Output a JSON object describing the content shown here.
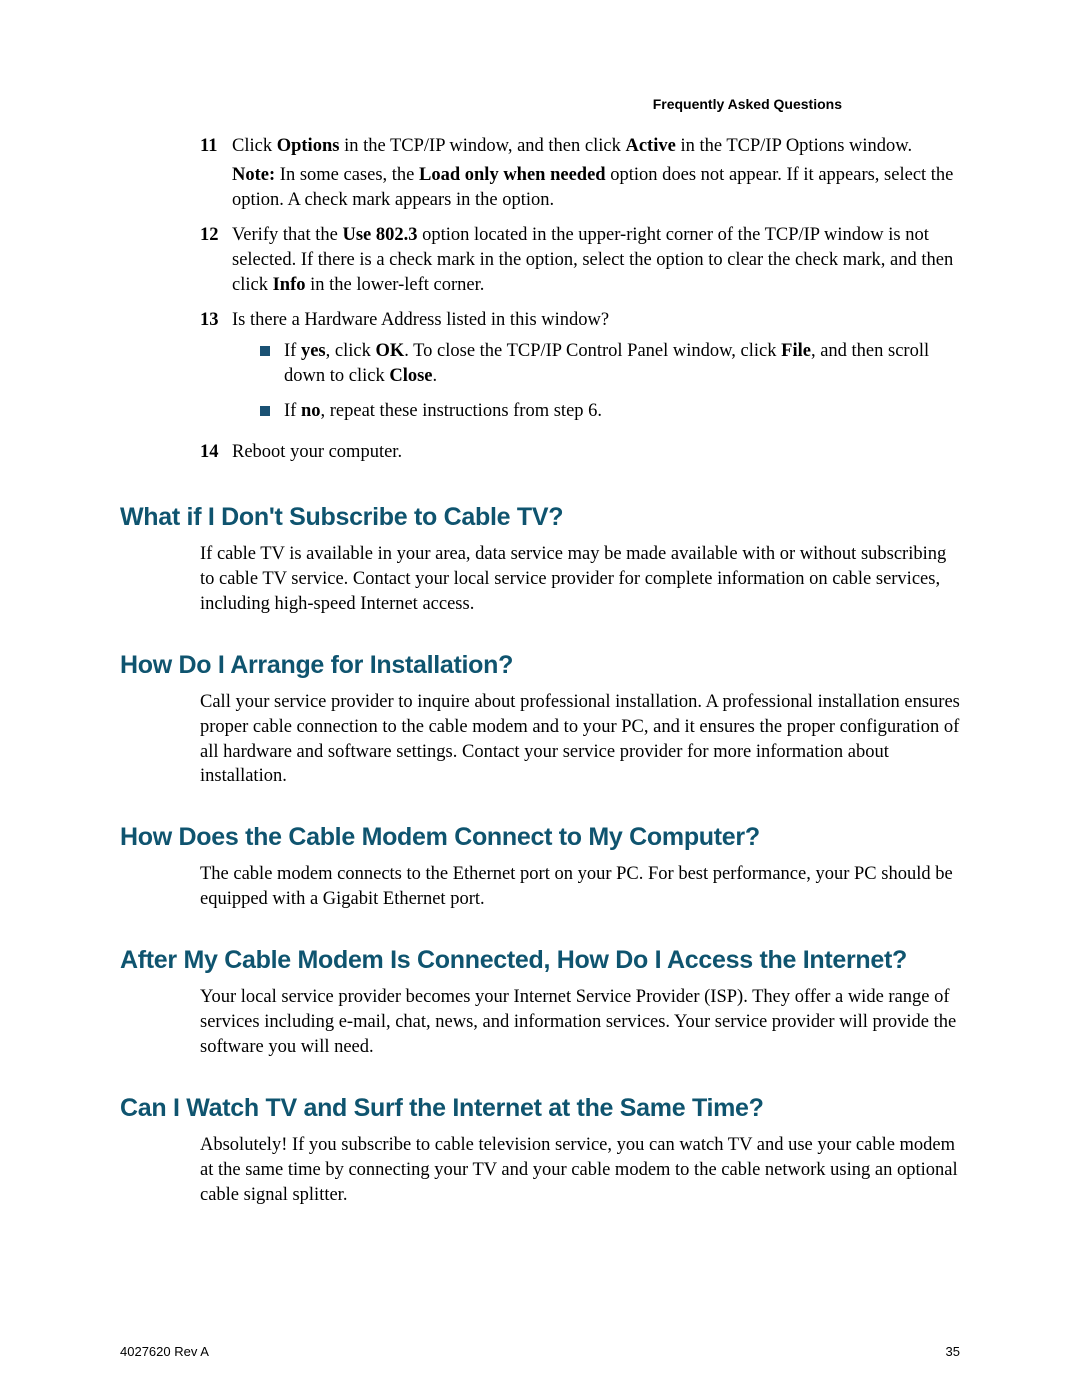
{
  "header": {
    "label": "Frequently Asked Questions"
  },
  "steps": {
    "s11": {
      "num": "11",
      "p1_a": "Click ",
      "p1_b": "Options",
      "p1_c": " in the TCP/IP window, and then click ",
      "p1_d": "Active",
      "p1_e": " in the TCP/IP Options window.",
      "p2_a": "Note:",
      "p2_b": " In some cases, the ",
      "p2_c": "Load only when needed",
      "p2_d": " option does not appear. If it appears, select the option. A check mark appears in the option."
    },
    "s12": {
      "num": "12",
      "a": "Verify that the ",
      "b": "Use 802.3",
      "c": " option located in the upper-right corner of the TCP/IP window is not selected. If there is a check mark in the option, select the option to clear the check mark, and then click ",
      "d": "Info",
      "e": " in the lower-left corner."
    },
    "s13": {
      "num": "13",
      "lead": "Is there a Hardware Address listed in this window?",
      "yes_a": "If ",
      "yes_b": "yes",
      "yes_c": ", click ",
      "yes_d": "OK",
      "yes_e": ". To close the TCP/IP Control Panel window, click ",
      "yes_f": "File",
      "yes_g": ", and then scroll down to click ",
      "yes_h": "Close",
      "yes_i": ".",
      "no_a": "If ",
      "no_b": "no",
      "no_c": ", repeat these instructions from step 6."
    },
    "s14": {
      "num": "14",
      "a": "Reboot your computer."
    }
  },
  "sections": {
    "cable_tv": {
      "heading": "What if I Don't Subscribe to Cable TV?",
      "body": "If cable TV is available in your area, data service may be made available with or without subscribing to cable TV service. Contact your local service provider for complete information on cable services, including high-speed Internet access."
    },
    "install": {
      "heading": "How Do I Arrange for Installation?",
      "body": "Call your service provider to inquire about professional installation. A professional installation ensures proper cable connection to the cable modem and to your PC, and it ensures the proper configuration of all hardware and software settings. Contact your service provider for more information about installation."
    },
    "connect": {
      "heading": "How Does the Cable Modem Connect to My Computer?",
      "body": "The cable modem connects to the Ethernet port on your PC. For best performance, your PC should be equipped with a Gigabit Ethernet port."
    },
    "access": {
      "heading": "After My Cable Modem Is Connected, How Do I Access the Internet?",
      "body": "Your local service provider becomes your Internet Service Provider (ISP). They offer a wide range of services including e-mail, chat, news, and information services. Your service provider will provide the software you will need."
    },
    "tv_surf": {
      "heading": "Can I Watch TV and Surf the Internet at the Same Time?",
      "body": "Absolutely! If you subscribe to cable television service, you can watch TV and use your cable modem at the same time by connecting your TV and your cable modem to the cable network using an optional cable signal splitter."
    }
  },
  "footer": {
    "left": "4027620 Rev A",
    "right": "35"
  }
}
